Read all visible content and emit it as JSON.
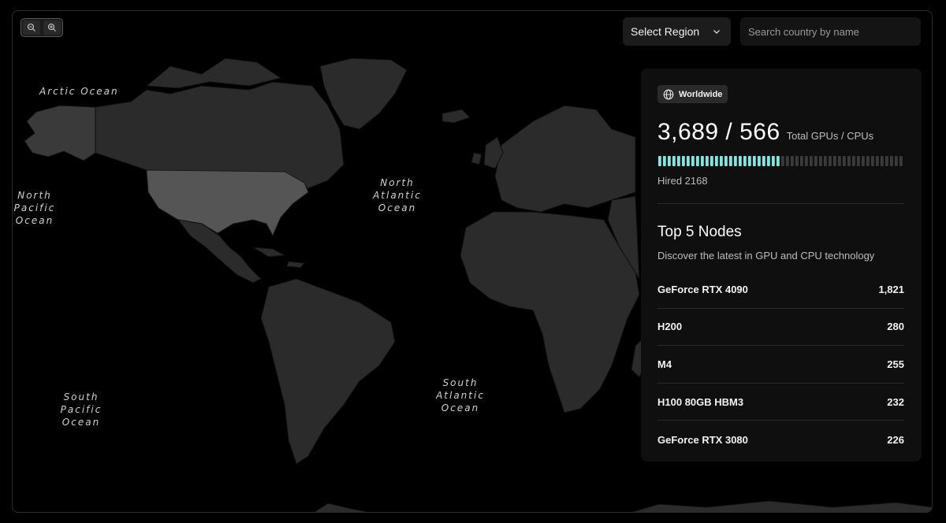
{
  "toolbar": {
    "zoom_out_icon": "zoom-out-icon",
    "zoom_in_icon": "zoom-in-icon",
    "region_select": {
      "selected": "Select Region",
      "icon": "chevron-down-icon"
    },
    "search": {
      "placeholder": "Search country by name",
      "value": ""
    }
  },
  "map": {
    "ocean_labels": {
      "arctic": "Arctic Ocean",
      "north_pacific": [
        "North",
        "Pacific",
        "Ocean"
      ],
      "north_atlantic": [
        "North",
        "Atlantic",
        "Ocean"
      ],
      "south_atlantic": [
        "South",
        "Atlantic",
        "Ocean"
      ],
      "south_pacific": [
        "South",
        "Pacific",
        "Ocean"
      ]
    },
    "colors": {
      "background": "#000000",
      "land": "#2b2b2b",
      "highlight": "#555555"
    }
  },
  "stats_panel": {
    "badge": {
      "icon": "globe-icon",
      "label": "Worldwide"
    },
    "totals_value": "3,689 / 566",
    "totals_label": "Total GPUs / CPUs",
    "hired_label": "Hired 2168",
    "hired_fraction": 0.5,
    "bar_colors": {
      "filled": "#7ee8e0",
      "empty": "#3a3a3a"
    },
    "top_title": "Top 5 Nodes",
    "top_subtitle": "Discover the latest in GPU and CPU technology",
    "nodes": [
      {
        "name": "GeForce RTX 4090",
        "count": "1,821"
      },
      {
        "name": "H200",
        "count": "280"
      },
      {
        "name": "M4",
        "count": "255"
      },
      {
        "name": "H100 80GB HBM3",
        "count": "232"
      },
      {
        "name": "GeForce RTX 3080",
        "count": "226"
      }
    ]
  }
}
